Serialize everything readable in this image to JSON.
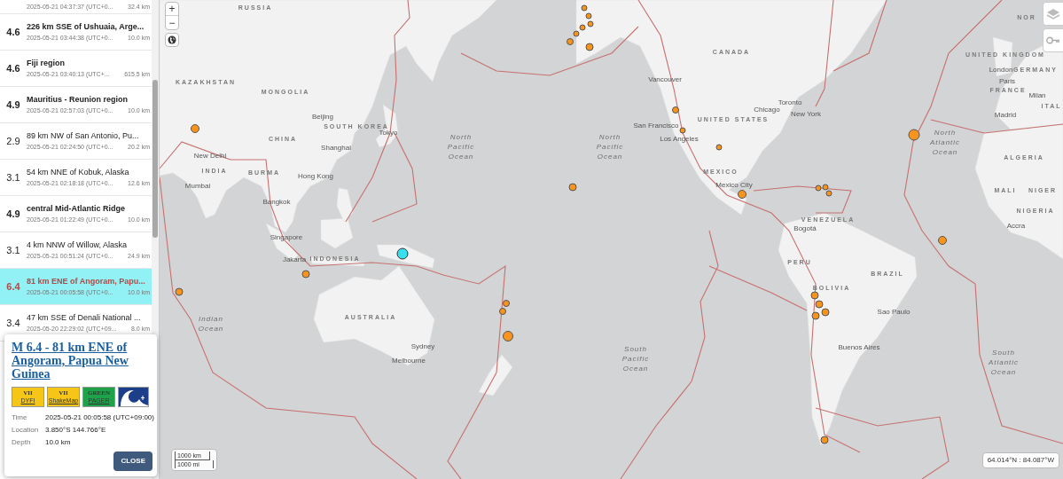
{
  "event_list": [
    {
      "time": "2025-05-21 04:37:37 (UTC+0...",
      "depth": "32.4 km",
      "selected": false
    },
    {
      "magnitude": "4.6",
      "title": "226 km SSE of Ushuaia, Arge...",
      "time": "2025-05-21 03:44:38 (UTC+0...",
      "depth": "10.0 km",
      "emphasized": true,
      "selected": false
    },
    {
      "magnitude": "4.6",
      "title": "Fiji region",
      "time": "2025-05-21 03:40:13 (UTC+...",
      "depth": "615.5 km",
      "emphasized": true,
      "selected": false
    },
    {
      "magnitude": "4.9",
      "title": "Mauritius - Reunion region",
      "time": "2025-05-21 02:57:03 (UTC+0...",
      "depth": "10.0 km",
      "emphasized": true,
      "selected": false
    },
    {
      "magnitude": "2.9",
      "title": "89 km NW of San Antonio, Pu...",
      "time": "2025-05-21 02:24:50 (UTC+0...",
      "depth": "20.2 km",
      "emphasized": false,
      "selected": false
    },
    {
      "magnitude": "3.1",
      "title": "54 km NNE of Kobuk, Alaska",
      "time": "2025-05-21 02:18:18 (UTC+0...",
      "depth": "12.6 km",
      "emphasized": false,
      "selected": false
    },
    {
      "magnitude": "4.9",
      "title": "central Mid-Atlantic Ridge",
      "time": "2025-05-21 01:22:49 (UTC+0...",
      "depth": "10.0 km",
      "emphasized": true,
      "selected": false
    },
    {
      "magnitude": "3.1",
      "title": "4 km NNW of Willow, Alaska",
      "time": "2025-05-21 00:51:24 (UTC+0...",
      "depth": "24.9 km",
      "emphasized": false,
      "selected": false
    },
    {
      "magnitude": "6.4",
      "title": "81 km ENE of Angoram, Papu...",
      "time": "2025-05-21 00:05:58 (UTC+0...",
      "depth": "10.0 km",
      "emphasized": true,
      "selected": true
    },
    {
      "magnitude": "3.4",
      "title": "47 km SSE of Denali National ...",
      "time": "2025-05-20 22:29:02 (UTC+09...",
      "depth": "8.0 km",
      "emphasized": false,
      "selected": false
    }
  ],
  "popup": {
    "title": "M 6.4 - 81 km ENE of Angoram, Papua New Guinea",
    "badges": [
      {
        "kind": "level",
        "value": "VII",
        "label": "DYFI",
        "color": "#f5c518"
      },
      {
        "kind": "level",
        "value": "VII",
        "label": "ShakeMap",
        "color": "#f5c518"
      },
      {
        "kind": "level",
        "value": "GREEN",
        "label": "PAGER",
        "color": "#1fa34a"
      },
      {
        "kind": "tsunami"
      }
    ],
    "details": [
      {
        "label": "Time",
        "value": "2025-05-21 00:05:58 (UTC+09:00)"
      },
      {
        "label": "Location",
        "value": "3.850°S 144.766°E"
      },
      {
        "label": "Depth",
        "value": "10.0 km"
      }
    ],
    "close_button": "CLOSE"
  },
  "zoom_controls": [
    "+",
    "−"
  ],
  "map_labels": [
    {
      "kind": "country",
      "text": "RUSSIA"
    },
    {
      "kind": "country",
      "text": "KAZAKHSTAN"
    },
    {
      "kind": "country",
      "text": "MONGOLIA"
    },
    {
      "kind": "city",
      "text": "Beijing"
    },
    {
      "kind": "country",
      "text": "SOUTH KOREA"
    },
    {
      "kind": "country",
      "text": "CHINA"
    },
    {
      "kind": "city",
      "text": "Tokyo"
    },
    {
      "kind": "city",
      "text": "Shanghai"
    },
    {
      "kind": "city",
      "text": "New Delhi"
    },
    {
      "kind": "country",
      "text": "INDIA"
    },
    {
      "kind": "country",
      "text": "BURMA"
    },
    {
      "kind": "city",
      "text": "Hong Kong"
    },
    {
      "kind": "city",
      "text": "Mumbai"
    },
    {
      "kind": "city",
      "text": "Bangkok"
    },
    {
      "kind": "city",
      "text": "Singapore"
    },
    {
      "kind": "city",
      "text": "Jakarta"
    },
    {
      "kind": "country",
      "text": "INDONESIA"
    },
    {
      "kind": "ocean",
      "text": "North Pacific Ocean"
    },
    {
      "kind": "ocean",
      "text": "North Pacific Ocean"
    },
    {
      "kind": "country",
      "text": "CANADA"
    },
    {
      "kind": "city",
      "text": "Vancouver"
    },
    {
      "kind": "country",
      "text": "UNITED STATES"
    },
    {
      "kind": "city",
      "text": "Chicago"
    },
    {
      "kind": "city",
      "text": "Toronto"
    },
    {
      "kind": "city",
      "text": "New York"
    },
    {
      "kind": "city",
      "text": "San Francisco"
    },
    {
      "kind": "city",
      "text": "Los Angeles"
    },
    {
      "kind": "country",
      "text": "MEXICO"
    },
    {
      "kind": "city",
      "text": "Mexico City"
    },
    {
      "kind": "country",
      "text": "VENEZUELA"
    },
    {
      "kind": "city",
      "text": "Bogotá"
    },
    {
      "kind": "country",
      "text": "PERU"
    },
    {
      "kind": "country",
      "text": "BRAZIL"
    },
    {
      "kind": "country",
      "text": "BOLIVIA"
    },
    {
      "kind": "city",
      "text": "Sao Paulo"
    },
    {
      "kind": "city",
      "text": "Buenos Aires"
    },
    {
      "kind": "country",
      "text": "NOR"
    },
    {
      "kind": "country",
      "text": "UNITED KINGDOM"
    },
    {
      "kind": "city",
      "text": "London"
    },
    {
      "kind": "country",
      "text": "GERMANY"
    },
    {
      "kind": "city",
      "text": "Paris"
    },
    {
      "kind": "country",
      "text": "FRANCE"
    },
    {
      "kind": "city",
      "text": "Milan"
    },
    {
      "kind": "country",
      "text": "ITAL"
    },
    {
      "kind": "city",
      "text": "Madrid"
    },
    {
      "kind": "country",
      "text": "ALGERIA"
    },
    {
      "kind": "country",
      "text": "MALI"
    },
    {
      "kind": "country",
      "text": "NIGER"
    },
    {
      "kind": "country",
      "text": "NIGERIA"
    },
    {
      "kind": "city",
      "text": "Accra"
    },
    {
      "kind": "ocean",
      "text": "North Atlantic Ocean"
    },
    {
      "kind": "ocean",
      "text": "South Atlantic Ocean"
    },
    {
      "kind": "ocean",
      "text": "South Pacific Ocean"
    },
    {
      "kind": "ocean",
      "text": "Indian Ocean"
    },
    {
      "kind": "country",
      "text": "AUSTRALIA"
    },
    {
      "kind": "city",
      "text": "Sydney"
    },
    {
      "kind": "city",
      "text": "Melbourne"
    }
  ],
  "markers": [
    {
      "selected": false
    },
    {
      "selected": false
    },
    {
      "selected": false
    },
    {
      "selected": false
    },
    {
      "selected": false
    },
    {
      "selected": false
    },
    {
      "selected": false
    },
    {
      "selected": false
    },
    {
      "selected": false
    },
    {
      "selected": true
    },
    {
      "selected": false
    },
    {
      "selected": false
    },
    {
      "selected": false
    },
    {
      "selected": false
    },
    {
      "selected": false
    },
    {
      "selected": false
    },
    {
      "selected": false
    },
    {
      "selected": false
    },
    {
      "selected": false
    },
    {
      "selected": false
    },
    {
      "selected": false
    },
    {
      "selected": false
    },
    {
      "selected": false
    },
    {
      "selected": false
    },
    {
      "selected": false
    },
    {
      "selected": false
    },
    {
      "selected": false
    },
    {
      "selected": false
    },
    {
      "selected": false
    }
  ],
  "scale": {
    "metric": "1000 km",
    "imperial": "1000 mi"
  },
  "coordinates": "64.014°N : 84.087°W"
}
